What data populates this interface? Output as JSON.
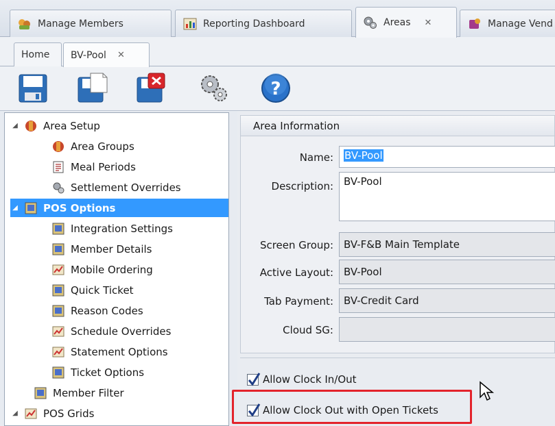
{
  "outer_tabs": [
    {
      "label": "Manage Members",
      "icon": "members-icon"
    },
    {
      "label": "Reporting Dashboard",
      "icon": "dashboard-icon"
    },
    {
      "label": "Areas",
      "icon": "gears-icon",
      "close": "✕"
    },
    {
      "label": "Manage Vend",
      "icon": "vendors-icon"
    }
  ],
  "inner_tabs": [
    {
      "label": "Home"
    },
    {
      "label": "BV-Pool",
      "close": "✕"
    }
  ],
  "toolbar": {
    "buttons": [
      "save-icon",
      "save-new-icon",
      "delete-icon",
      "gears-icon",
      "help-icon"
    ]
  },
  "tree": {
    "nodes": [
      {
        "label": "Area Setup",
        "expander": "◢"
      },
      {
        "label": "Area Groups"
      },
      {
        "label": "Meal Periods"
      },
      {
        "label": "Settlement Overrides"
      },
      {
        "label": "POS Options",
        "expander": "◢",
        "selected": true
      },
      {
        "label": "Integration Settings"
      },
      {
        "label": "Member Details"
      },
      {
        "label": "Mobile Ordering"
      },
      {
        "label": "Quick Ticket"
      },
      {
        "label": "Reason Codes"
      },
      {
        "label": "Schedule Overrides"
      },
      {
        "label": "Statement Options"
      },
      {
        "label": "Ticket Options"
      },
      {
        "label": "Member Filter"
      },
      {
        "label": "POS Grids",
        "expander": "◢"
      }
    ]
  },
  "area_info": {
    "header": "Area Information",
    "name_label": "Name:",
    "name_value": "BV-Pool",
    "description_label": "Description:",
    "description_value": "BV-Pool",
    "screen_group_label": "Screen Group:",
    "screen_group_value": "BV-F&B Main Template",
    "active_layout_label": "Active Layout:",
    "active_layout_value": "BV-Pool",
    "tab_payment_label": "Tab Payment:",
    "tab_payment_value": "BV-Credit Card",
    "cloud_sg_label": "Cloud SG:",
    "cloud_sg_value": ""
  },
  "checkboxes": {
    "allow_clock_in_out": {
      "label": "Allow Clock In/Out",
      "checked": true
    },
    "allow_clock_out_open": {
      "label": "Allow Clock Out with Open Tickets",
      "checked": true
    }
  },
  "colors": {
    "selection": "#3399ff",
    "highlight_border": "#e3232b"
  }
}
